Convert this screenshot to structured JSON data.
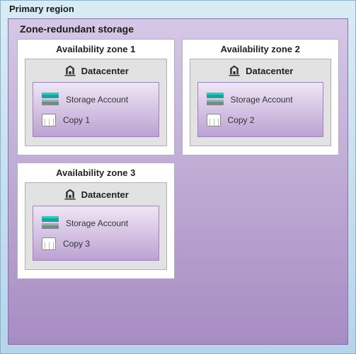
{
  "primary_region": {
    "title": "Primary region"
  },
  "zrs": {
    "title": "Zone-redundant storage"
  },
  "zones": [
    {
      "title": "Availability zone 1",
      "datacenter_label": "Datacenter",
      "storage_label": "Storage Account",
      "copy_label": "Copy 1"
    },
    {
      "title": "Availability zone 2",
      "datacenter_label": "Datacenter",
      "storage_label": "Storage Account",
      "copy_label": "Copy 2"
    },
    {
      "title": "Availability zone 3",
      "datacenter_label": "Datacenter",
      "storage_label": "Storage Account",
      "copy_label": "Copy 3"
    }
  ],
  "colors": {
    "region_bg_top": "#d8ecf4",
    "region_bg_bottom": "#b6d4ea",
    "zrs_bg_top": "#d5c8e5",
    "zrs_bg_bottom": "#a78cc2",
    "storage_accent": "#1aa398",
    "copy_accent": "#6a4bcf"
  }
}
